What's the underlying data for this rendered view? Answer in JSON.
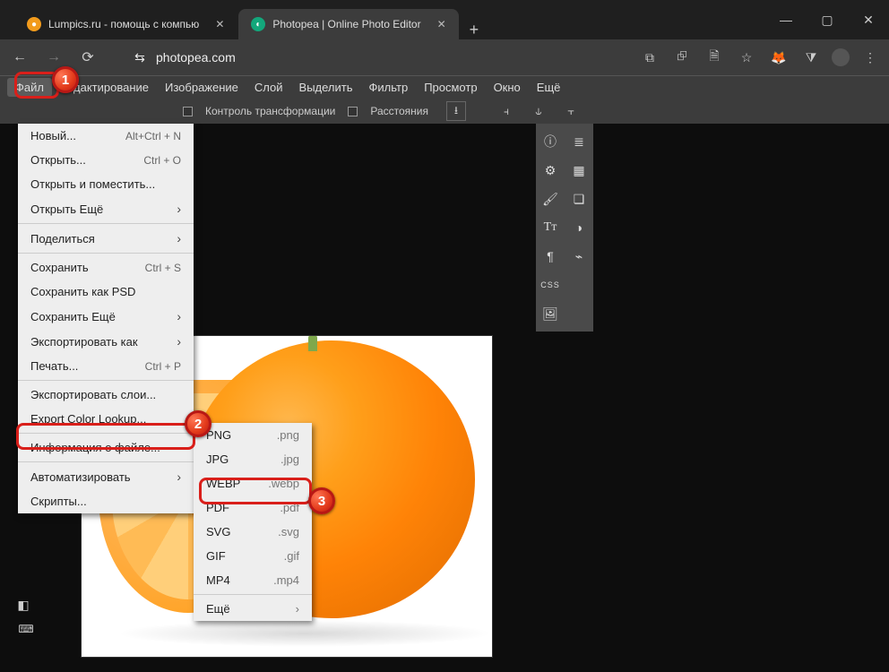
{
  "window": {
    "tabs": [
      {
        "title": "Lumpics.ru - помощь с компью",
        "favicon_color": "#f29b1c"
      },
      {
        "title": "Photopea | Online Photo Editor",
        "favicon_color": "#13a77b"
      }
    ],
    "controls": {
      "min": "—",
      "max": "▢",
      "close": "✕"
    }
  },
  "addressbar": {
    "back": "←",
    "forward": "→",
    "reload": "⟳",
    "site_icon": "⇆",
    "url": "photopea.com",
    "right_icons": [
      "⧉",
      "⮺",
      "🗎",
      "☆"
    ],
    "fox": "🦊",
    "ext": "⧩",
    "menu": "⋮"
  },
  "menubar": {
    "items": [
      "Файл",
      "Редактирование",
      "Изображение",
      "Слой",
      "Выделить",
      "Фильтр",
      "Просмотр",
      "Окно",
      "Ещё"
    ],
    "open_index": 0
  },
  "optbar": {
    "transform_label": "Контроль трансформации",
    "distances_label": "Расстояния",
    "download": "⭳"
  },
  "file_menu": {
    "items": [
      {
        "label": "Новый...",
        "shortcut": "Alt+Ctrl + N"
      },
      {
        "label": "Открыть...",
        "shortcut": "Ctrl + O"
      },
      {
        "label": "Открыть и поместить..."
      },
      {
        "label": "Открыть Ещё",
        "submenu": true
      },
      {
        "sep": true
      },
      {
        "label": "Поделиться",
        "submenu": true
      },
      {
        "sep": true
      },
      {
        "label": "Сохранить",
        "shortcut": "Ctrl + S"
      },
      {
        "label": "Сохранить как PSD"
      },
      {
        "label": "Сохранить Ещё",
        "submenu": true
      },
      {
        "label": "Экспортировать как",
        "submenu": true,
        "highlight": true
      },
      {
        "label": "Печать...",
        "shortcut": "Ctrl + P"
      },
      {
        "sep": true
      },
      {
        "label": "Экспортировать слои..."
      },
      {
        "label": "Export Color Lookup..."
      },
      {
        "sep": true
      },
      {
        "label": "Информация о файле..."
      },
      {
        "sep": true
      },
      {
        "label": "Автоматизировать",
        "submenu": true
      },
      {
        "label": "Скрипты..."
      }
    ]
  },
  "export_submenu": {
    "items": [
      {
        "label": "PNG",
        "ext": ".png"
      },
      {
        "label": "JPG",
        "ext": ".jpg"
      },
      {
        "label": "WEBP",
        "ext": ".webp",
        "highlight": true
      },
      {
        "label": "PDF",
        "ext": ".pdf"
      },
      {
        "label": "SVG",
        "ext": ".svg"
      },
      {
        "label": "GIF",
        "ext": ".gif"
      },
      {
        "label": "MP4",
        "ext": ".mp4"
      },
      {
        "sep": true
      },
      {
        "label": "Ещё",
        "submenu": true
      }
    ]
  },
  "markers": {
    "1": "1",
    "2": "2",
    "3": "3"
  },
  "right_panel_css": "CSS"
}
